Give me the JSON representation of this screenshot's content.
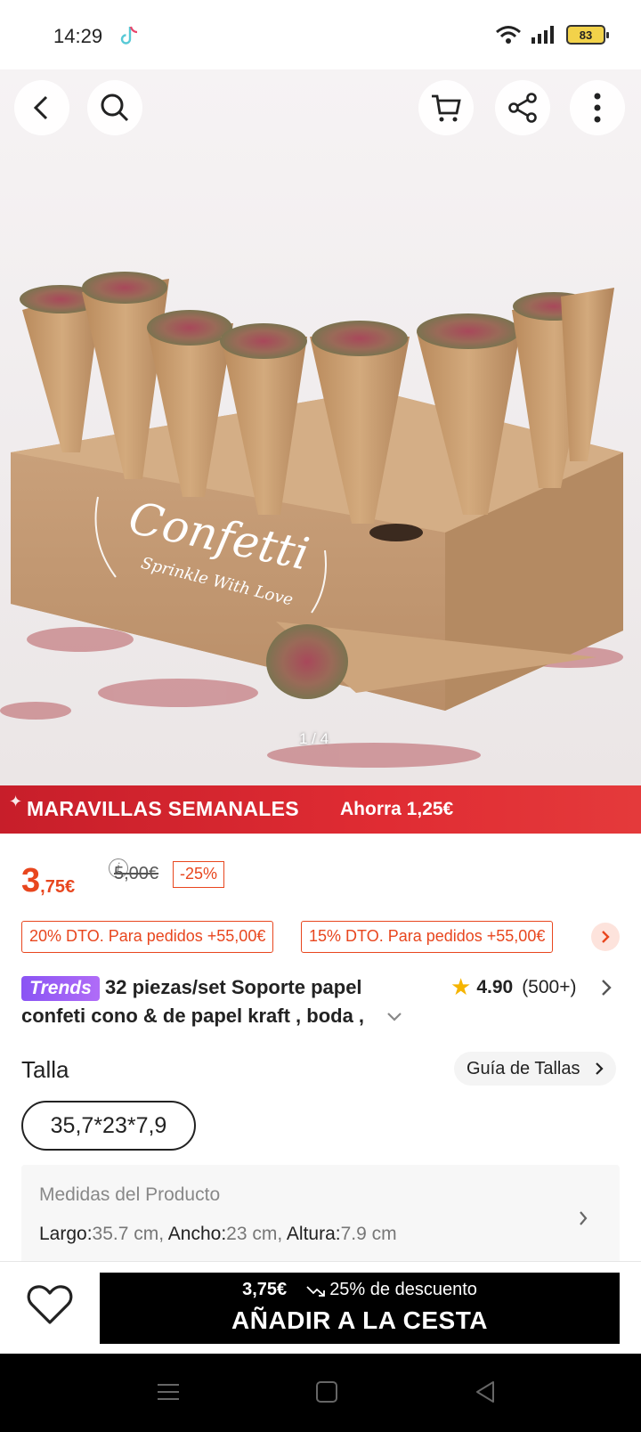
{
  "status_bar": {
    "time": "14:29",
    "battery": "83",
    "icons": [
      "tiktok-icon",
      "wifi-icon",
      "signal-icon",
      "battery-icon"
    ]
  },
  "gallery": {
    "counter": "1 / 4",
    "box_text_main": "Confetti",
    "box_text_sub": "Sprinkle With Love"
  },
  "promo": {
    "title": "MARAVILLAS SEMANALES",
    "saving": "Ahorra 1,25€"
  },
  "price": {
    "main": "3",
    "cents": ",75€",
    "old": "5,00€",
    "discount": "-25%"
  },
  "coupons": [
    {
      "label": "20% DTO. Para pedidos +55,00€"
    },
    {
      "label": "15% DTO. Para pedidos +55,00€"
    }
  ],
  "product": {
    "badge": "Trends",
    "title_line1": "32 piezas/set Soporte papel",
    "title_line2": "confeti cono & de papel kraft , boda ,",
    "rating": "4.90",
    "reviews": "(500+)"
  },
  "size": {
    "label": "Talla",
    "guide": "Guía de Tallas",
    "selected": "35,7*23*7,9"
  },
  "measures": {
    "title": "Medidas del Producto",
    "largo_label": "Largo:",
    "largo_value": "35.7 cm,",
    "ancho_label": "Ancho:",
    "ancho_value": "23 cm,",
    "altura_label": "Altura:",
    "altura_value": "7.9 cm"
  },
  "action": {
    "price": "3,75€",
    "discount": "25% de descuento",
    "button": "AÑADIR A LA CESTA"
  },
  "colors": {
    "accent": "#e8461e",
    "promo_red": "#e02c33",
    "trends_purple": "#9b5ff5",
    "kraft": "#c99b6b"
  }
}
